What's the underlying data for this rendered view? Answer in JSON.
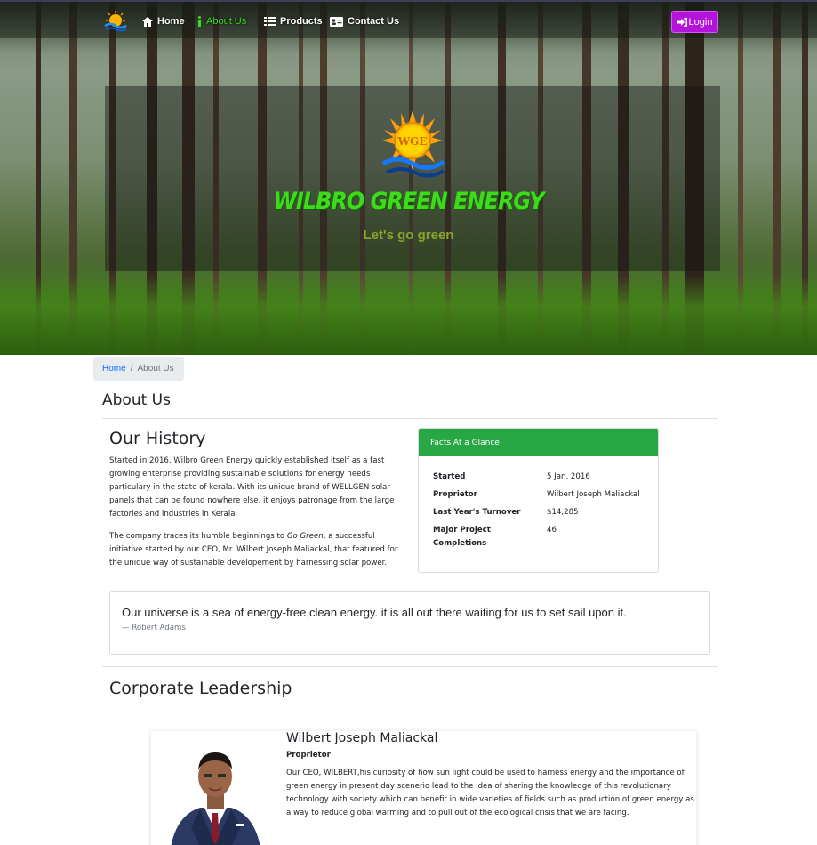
{
  "nav": {
    "home": "Home",
    "about": "About Us",
    "products": "Products",
    "contact": "Contact Us",
    "login": "Login"
  },
  "hero": {
    "logo_text": "WGE",
    "title": "WILBRO GREEN ENERGY",
    "tagline": "Let's go green"
  },
  "breadcrumb": {
    "home": "Home",
    "separator": "/",
    "current": "About Us"
  },
  "page_title": "About Us",
  "history": {
    "heading": "Our History",
    "p1": "Started in 2016, Wilbro Green Energy quickly established itself as a fast growing enterprise providing sustainable solutions for energy needs particulary in the state of kerala. With its unique brand of WELLGEN solar panels that can be found nowhere else, it enjoys patronage from the large factories and industries in Kerala.",
    "p2_before": "The company traces its humble beginnings to ",
    "p2_em": "Go Green",
    "p2_after": ", a successful initiative started by our CEO, Mr. Wilbert Joseph Maliackal, that featured for the unique way of sustainable developement by harnessing solar power."
  },
  "facts": {
    "heading": "Facts At a Glance",
    "rows": [
      {
        "label": "Started",
        "value": "5 Jan. 2016"
      },
      {
        "label": "Proprietor",
        "value": "Wilbert Joseph Maliackal"
      },
      {
        "label": "Last Year's Turnover",
        "value": "$14,285"
      },
      {
        "label": "Major Project Completions",
        "value": "46"
      }
    ]
  },
  "quote": {
    "text": "Our universe is a sea of energy-free,clean energy. it is all out there waiting for us to set sail upon it.",
    "author": "— Robert Adams"
  },
  "leadership": {
    "heading": "Corporate Leadership",
    "name": "Wilbert Joseph Maliackal",
    "role": "Proprietor",
    "bio": "Our CEO, WILBERT,his curiosity of how sun light could be used to harness energy and the importance of green energy in present day scenerio lead to the idea of sharing the knowledge of this revolutionary technology with society which can benefit in wide varieties of fields such as production of green energy as a way to reduce global warming and to pull out of the ecological crisis that we are facing."
  },
  "colors": {
    "accent_green": "#28a745",
    "title_green": "#3ddc1a",
    "login_purple": "#b414d9",
    "link_blue": "#0d6efd"
  },
  "icons": [
    "home-icon",
    "info-icon",
    "list-icon",
    "address-card-icon",
    "sign-in-icon"
  ]
}
